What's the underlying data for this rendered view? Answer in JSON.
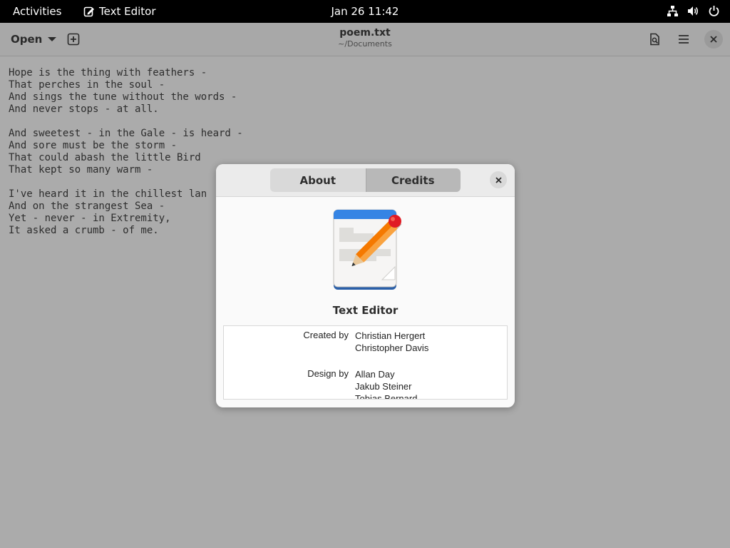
{
  "topbar": {
    "activities": "Activities",
    "app_name": "Text Editor",
    "clock": "Jan 26  11:42",
    "tray_icons": [
      "network-icon",
      "volume-icon",
      "power-icon"
    ]
  },
  "headerbar": {
    "open_label": "Open",
    "title": "poem.txt",
    "subtitle": "~/Documents"
  },
  "editor": {
    "lines": [
      "Hope is the thing with feathers -",
      "That perches in the soul -",
      "And sings the tune without the words -",
      "And never stops - at all.",
      "",
      "And sweetest - in the Gale - is heard -",
      "And sore must be the storm -",
      "That could abash the little Bird",
      "That kept so many warm -",
      "",
      "I've heard it in the chillest lan",
      "And on the strangest Sea -",
      "Yet - never - in Extremity,",
      "It asked a crumb - of me."
    ]
  },
  "dialog": {
    "tabs": [
      {
        "label": "About",
        "active": false
      },
      {
        "label": "Credits",
        "active": true
      }
    ],
    "app_name": "Text Editor",
    "credits": [
      {
        "label": "Created by",
        "names": [
          "Christian Hergert",
          "Christopher Davis"
        ]
      },
      {
        "label": "Design by",
        "names": [
          "Allan Day",
          "Jakub Steiner",
          "Tobias Bernard"
        ]
      }
    ]
  },
  "colors": {
    "topbar_bg": "#000000",
    "window_bg_dimmed": "#ababab",
    "dialog_bg": "#fafafa",
    "tab_active_bg": "#b8b8b8",
    "icon_header_blue": "#3584e4",
    "pencil_orange": "#f57900"
  }
}
